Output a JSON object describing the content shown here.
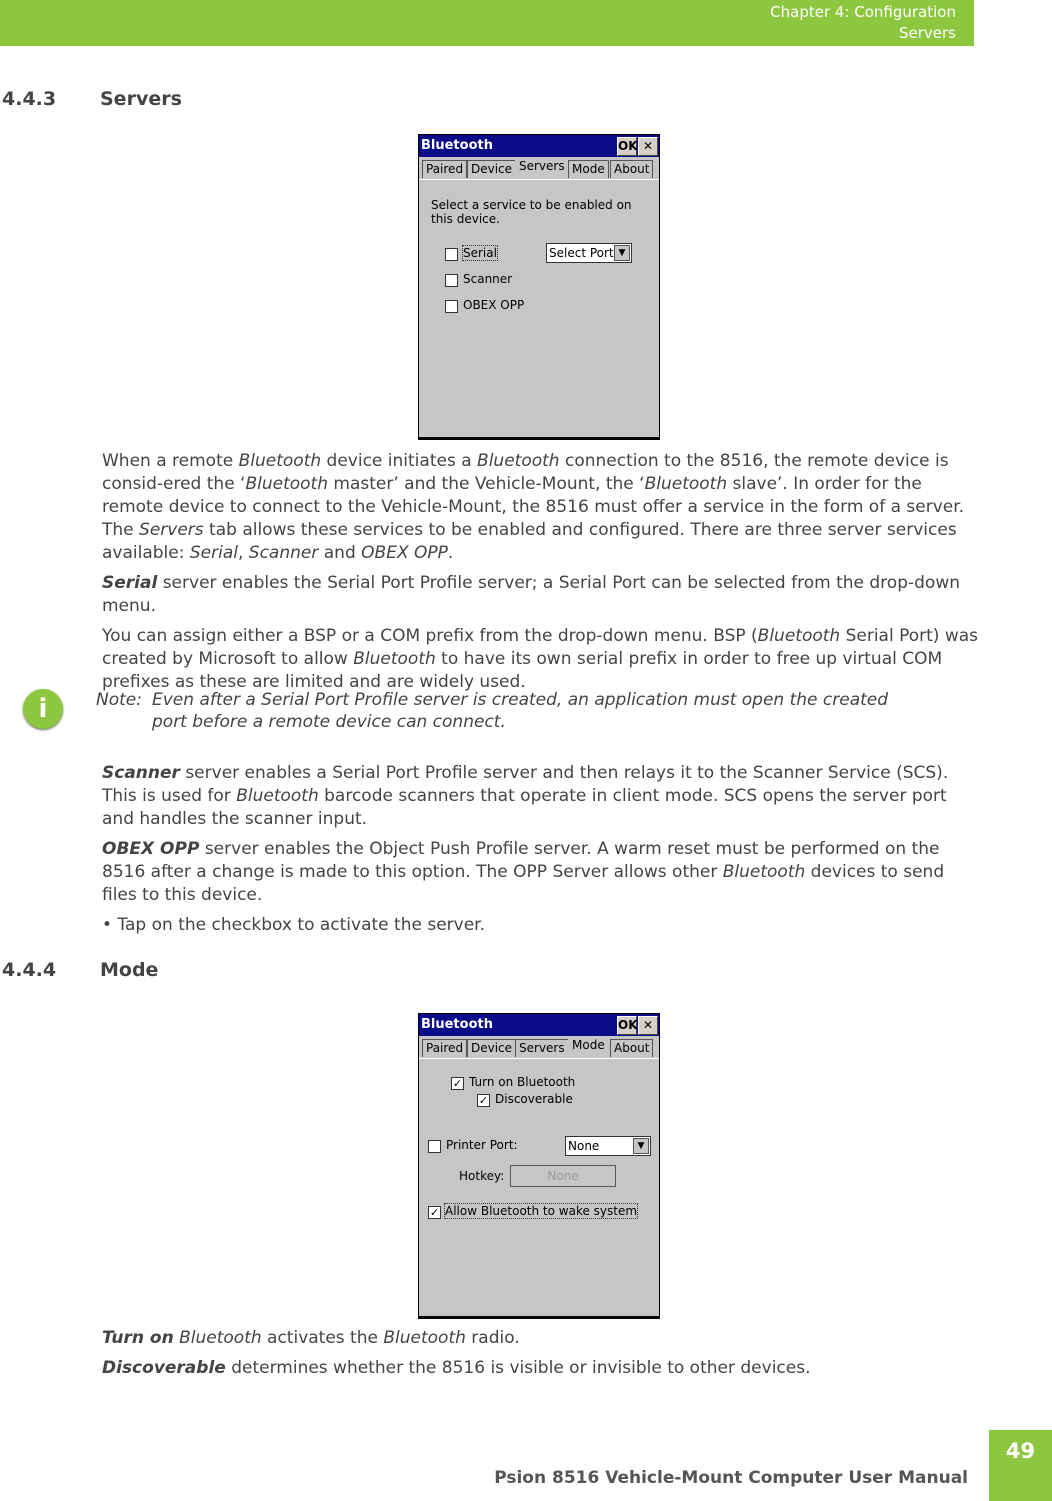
{
  "header": {
    "chapter": "Chapter 4:  Configuration",
    "section": "Servers"
  },
  "sections": {
    "servers": {
      "number": "4.4.3",
      "title": "Servers"
    },
    "mode": {
      "number": "4.4.4",
      "title": "Mode"
    }
  },
  "servers_window": {
    "title": "Bluetooth",
    "ok": "OK",
    "close": "✕",
    "tabs": [
      "Paired",
      "Device",
      "Servers",
      "Mode",
      "About"
    ],
    "active_tab": "Servers",
    "instruction": "Select a service to be enabled on this device.",
    "options": [
      {
        "label": "Serial",
        "checked": false
      },
      {
        "label": "Scanner",
        "checked": false
      },
      {
        "label": "OBEX OPP",
        "checked": false
      }
    ],
    "port_select": "Select Port"
  },
  "mode_window": {
    "title": "Bluetooth",
    "ok": "OK",
    "close": "✕",
    "tabs": [
      "Paired",
      "Device",
      "Servers",
      "Mode",
      "About"
    ],
    "active_tab": "Mode",
    "turn_on": "Turn on Bluetooth",
    "discoverable": "Discoverable",
    "printer_port": "Printer Port:",
    "printer_value": "None",
    "hotkey": "Hotkey:",
    "hotkey_value": "None",
    "wake": "Allow Bluetooth to wake system"
  },
  "servers_text": [
    [
      [
        "When a remote ",
        ""
      ],
      [
        "Bluetooth",
        "i"
      ],
      [
        " device initiates a ",
        ""
      ],
      [
        "Bluetooth",
        "i"
      ],
      [
        " connection to the 8516, the remote device is consid-ered the ‘",
        ""
      ],
      [
        "Bluetooth",
        "i"
      ],
      [
        " master’ and the Vehicle-Mount, the ‘",
        ""
      ],
      [
        "Bluetooth",
        "i"
      ],
      [
        " slave’. In order for the remote device to connect to the Vehicle-Mount, the 8516 must offer a service in the form of a server. The ",
        ""
      ],
      [
        "Servers",
        "i"
      ],
      [
        " tab allows these services to be enabled and configured. There are three server services available: ",
        ""
      ],
      [
        "Serial",
        "i"
      ],
      [
        ", ",
        ""
      ],
      [
        "Scanner",
        "i"
      ],
      [
        " and ",
        ""
      ],
      [
        "OBEX OPP",
        "i"
      ],
      [
        ".",
        ""
      ]
    ],
    [
      [
        "Serial",
        "bi"
      ],
      [
        " server enables the Serial Port Profile server; a Serial Port can be selected from the drop-down menu.",
        ""
      ]
    ],
    [
      [
        "You can assign either a BSP or a COM prefix from the drop-down menu. BSP (",
        ""
      ],
      [
        "Bluetooth",
        "i"
      ],
      [
        " Serial Port) was created by Microsoft to allow ",
        ""
      ],
      [
        "Bluetooth",
        "i"
      ],
      [
        " to have its own serial prefix in order to free up virtual COM prefixes as these are limited and are widely used.",
        ""
      ]
    ]
  ],
  "note": {
    "label": "Note:",
    "text": "Even after a Serial Port Profile server is created, an application must open the created port before a remote device can connect."
  },
  "servers_text2": [
    [
      [
        "Scanner",
        "bi"
      ],
      [
        " server enables a Serial Port Profile server and then relays it to the Scanner Service (SCS). This is used for ",
        ""
      ],
      [
        "Bluetooth",
        "i"
      ],
      [
        " barcode scanners that operate in client mode. SCS opens the server port and handles the scanner input.",
        ""
      ]
    ],
    [
      [
        "OBEX OPP",
        "bi"
      ],
      [
        " server enables the Object Push Profile server. A warm reset must be performed on the 8516 after a change is made to this option. The OPP Server allows other ",
        ""
      ],
      [
        "Bluetooth",
        "i"
      ],
      [
        " devices to send files to this device.",
        ""
      ]
    ],
    [
      [
        "•      Tap on the checkbox to activate the server.",
        ""
      ]
    ]
  ],
  "mode_text": [
    [
      [
        "Turn on",
        "bi"
      ],
      [
        " ",
        ""
      ],
      [
        "Bluetooth",
        "i"
      ],
      [
        " activates the ",
        ""
      ],
      [
        "Bluetooth",
        "i"
      ],
      [
        " radio.",
        ""
      ]
    ],
    [
      [
        "Discoverable",
        "bi"
      ],
      [
        " determines whether the 8516 is visible or invisible to other devices.",
        ""
      ]
    ]
  ],
  "footer": {
    "title": "Psion 8516 Vehicle-Mount Computer User Manual",
    "page": "49"
  },
  "colors": {
    "accent": "#8dc63f",
    "titlebar": "#0c0c88"
  }
}
